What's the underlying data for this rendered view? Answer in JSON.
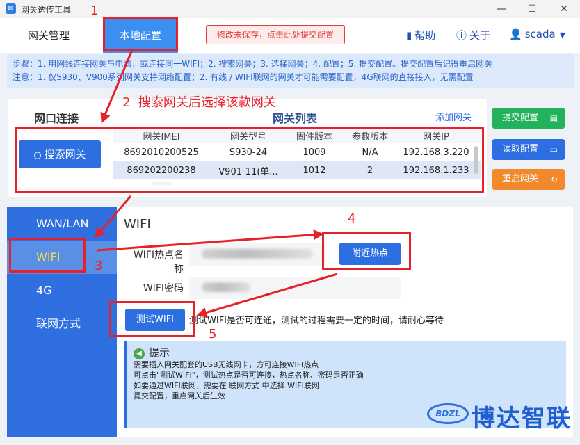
{
  "window": {
    "title": "网关透传工具",
    "minimize": "—",
    "maximize": "☐",
    "close": "✕"
  },
  "header": {
    "tabs": [
      {
        "label": "网关管理"
      },
      {
        "label": "本地配置"
      }
    ],
    "unsaved_notice": "修改未保存，点击此处提交配置",
    "help": "帮助",
    "about": "关于",
    "user": "scada"
  },
  "steps": {
    "line1": "步骤：1. 用网线连接网关与电脑，或连接同一WIFI；2. 搜索网关；3. 选择网关；4. 配置；5. 提交配置。提交配置后记得重启网关",
    "line2": "注意：1. 仅S930、V900系列网关支持网络配置；2. 有线 / WIFI联网的网关才可能需要配置，4G联网的直接接入，无需配置"
  },
  "network": {
    "left_title": "网口连接",
    "search_label": "搜索网关",
    "list_title": "网关列表",
    "add_link": "添加网关",
    "columns": [
      "网关IMEI",
      "网关型号",
      "固件版本",
      "参数版本",
      "网关IP"
    ],
    "rows": [
      [
        "8692010200525",
        "S930-24",
        "1009",
        "N/A",
        "192.168.3.220"
      ],
      [
        "869202200238",
        "V901-11(单...",
        "1012",
        "2",
        "192.168.1.233"
      ]
    ],
    "buttons": {
      "submit": "提交配置",
      "read": "读取配置",
      "restart": "重启网关"
    }
  },
  "menu": {
    "items": [
      "WAN/LAN",
      "WIFI",
      "4G",
      "联网方式"
    ],
    "active": "WIFI"
  },
  "wifi": {
    "title": "WIFI",
    "ssid_label": "WIFI热点名称",
    "nearby_button": "附近热点",
    "password_label": "WIFI密码",
    "test_button": "测试WIFI",
    "test_desc": "测试WIFI是否可连通，测试的过程需要一定的时间，请耐心等待"
  },
  "tip": {
    "title": "提示",
    "lines": [
      "需要插入网关配套的USB无线网卡，方可连接WIFI热点",
      "可点击\"测试WIFI\"，测试热点是否可连接，热点名称、密码是否正确",
      "如要通过WIFI联网，需要在 联网方式 中选择 WIFI联网",
      "提交配置，重启网关后生效"
    ]
  },
  "watermark": {
    "logo": "BDZL",
    "text": "博达智联"
  },
  "annotations": {
    "n1": "1",
    "n2": "2",
    "n2_text": "搜索网关后选择该款网关",
    "n3": "3",
    "n4": "4",
    "n5": "5",
    "color": "#e8202a"
  },
  "colors": {
    "primary": "#2d6fe0",
    "submit": "#21b25b",
    "read": "#2d6fe0",
    "restart": "#f08a2c",
    "tab_active": "#3b8ff1"
  }
}
